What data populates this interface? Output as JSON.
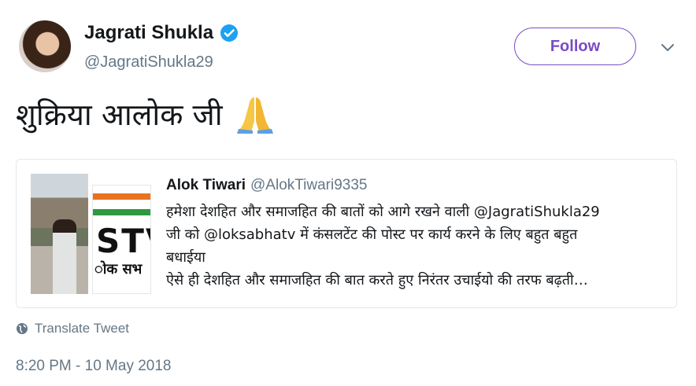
{
  "author": {
    "name": "Jagrati Shukla",
    "handle": "@JagratiShukla29",
    "verified": true
  },
  "follow_label": "Follow",
  "tweet_text": "शुक्रिया आलोक जी",
  "emoji": "folded-hands",
  "quoted_tweet": {
    "author_name": "Alok Tiwari",
    "author_handle": "@AlokTiwari9335",
    "lines": [
      "हमेशा देशहित और समाजहित की बातों को आगे रखने वाली @JagratiShukla29",
      "जी को @loksabhatv में कंसलटेंट की पोस्ट पर कार्य करने के लिए बहुत बहुत",
      "बधाईया",
      "ऐसे ही देशहित और समाजहित की बात करते हुए निरंतर उचाईयो की तरफ बढ़ती…"
    ]
  },
  "translate_label": "Translate Tweet",
  "timestamp": "8:20 PM - 10 May 2018",
  "colors": {
    "accent": "#794bc4",
    "verified": "#1da1f2",
    "secondary_text": "#657786",
    "border": "#e1e8ed"
  }
}
